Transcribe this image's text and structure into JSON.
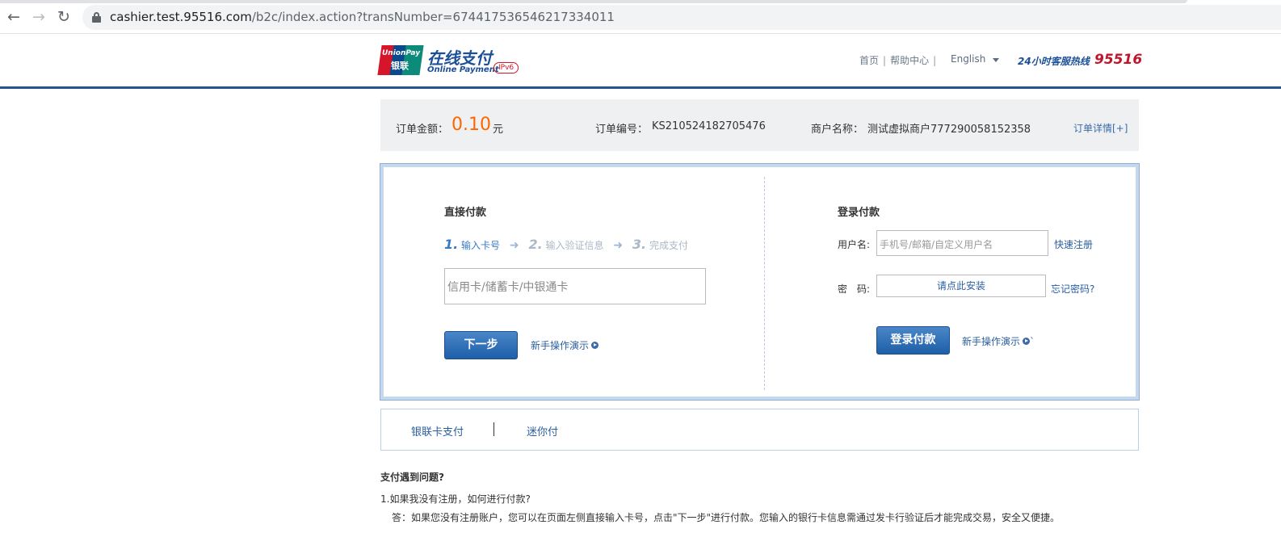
{
  "browser": {
    "url_host": "cashier.test.95516.com",
    "url_path": "/b2c/index.action?transNumber=674417536546217334011"
  },
  "header": {
    "logo_text_en": "UnionPay",
    "logo_text_cn": "银联",
    "brand_cn": "在线支付",
    "brand_en": "Online Payment",
    "ipv6_badge": "IPv6",
    "nav": {
      "home": "首页",
      "help": "帮助中心",
      "sep": "|",
      "language": "English"
    },
    "hotline_label": "24小时客服热线",
    "hotline_number": "95516"
  },
  "order": {
    "amount_label": "订单金额：",
    "amount_value": "0.10",
    "amount_unit": "元",
    "order_no_label": "订单编号：",
    "order_no_value": "KS210524182705476",
    "merchant_label": "商户名称：",
    "merchant_value": "测试虚拟商户777290058152358",
    "detail_link": "订单详情[+]"
  },
  "direct_pay": {
    "title": "直接付款",
    "steps": [
      {
        "num": "1.",
        "label": "输入卡号"
      },
      {
        "num": "2.",
        "label": "输入验证信息"
      },
      {
        "num": "3.",
        "label": "完成支付"
      }
    ],
    "card_placeholder": "信用卡/储蓄卡/中银通卡",
    "next_button": "下一步",
    "guide_link": "新手操作演示"
  },
  "login_pay": {
    "title": "登录付款",
    "username_label": "用户名:",
    "username_placeholder": "手机号/邮箱/自定义用户名",
    "register_link": "快速注册",
    "password_label": "密　码:",
    "password_install": "请点此安装",
    "forgot_link": "忘记密码?",
    "login_button": "登录付款",
    "guide_link": "新手操作演示",
    "guide_suffix": "`"
  },
  "tabs": {
    "card_pay": "银联卡支付",
    "mini_pay": "迷你付"
  },
  "faq": {
    "heading": "支付遇到问题?",
    "q1": "1.如果我没有注册，如何进行付款?",
    "a1": "答：如果您没有注册账户，您可以在页面左侧直接输入卡号，点击\"下一步\"进行付款。您输入的银行卡信息需通过发卡行验证后才能完成交易，安全又便捷。"
  },
  "colors": {
    "brand_blue": "#245593",
    "amount_orange": "#ff6600",
    "hotline_red": "#c0152a"
  }
}
